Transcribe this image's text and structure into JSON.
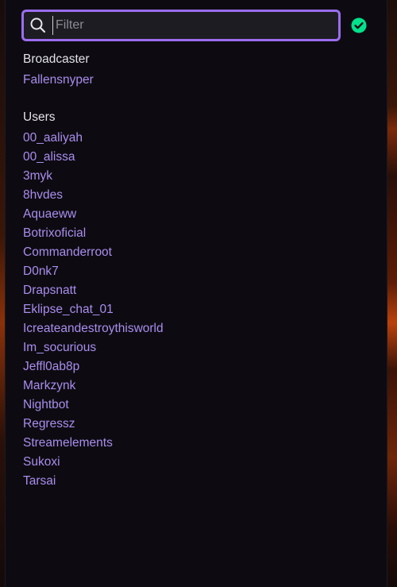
{
  "filter": {
    "placeholder": "Filter",
    "status_icon": "check-circle-icon",
    "accent_color": "#9b6df0",
    "status_color": "#00e28c"
  },
  "broadcaster": {
    "title": "Broadcaster",
    "name": "Fallensnyper"
  },
  "users": {
    "title": "Users",
    "names": [
      "00_aaliyah",
      "00_alissa",
      "3myk",
      "8hvdes",
      "Aquaeww",
      "Botrixoficial",
      "Commanderroot",
      "D0nk7",
      "Drapsnatt",
      "Eklipse_chat_01",
      "Icreateandestroythisworld",
      "Im_socurious",
      "Jeffl0ab8p",
      "Markzynk",
      "Nightbot",
      "Regressz",
      "Streamelements",
      "Sukoxi",
      "Tarsai"
    ]
  }
}
